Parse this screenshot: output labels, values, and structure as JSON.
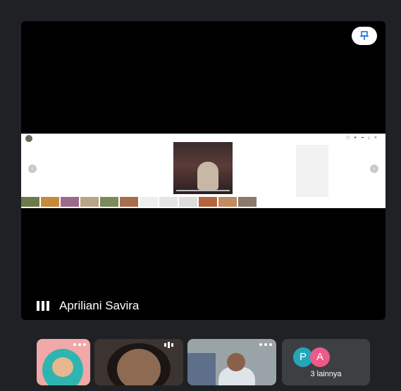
{
  "main_tile": {
    "participant_name": "Apriliani Savira",
    "pin_icon": "pin-icon",
    "audio_icon": "audio-level-icon"
  },
  "filmstrip": {
    "tiles": [
      {
        "kind": "video",
        "icon": "more-options-icon"
      },
      {
        "kind": "video",
        "icon": "speaking-indicator-icon"
      },
      {
        "kind": "video",
        "icon": "more-options-icon"
      }
    ],
    "more": {
      "avatars": [
        {
          "letter": "P",
          "color": "#26a5b8"
        },
        {
          "letter": "A",
          "color": "#ec5a8a"
        }
      ],
      "label": "3 lainnya"
    }
  },
  "colors": {
    "background": "#202124",
    "tile": "#3c4043",
    "video_bg": "#000000"
  }
}
